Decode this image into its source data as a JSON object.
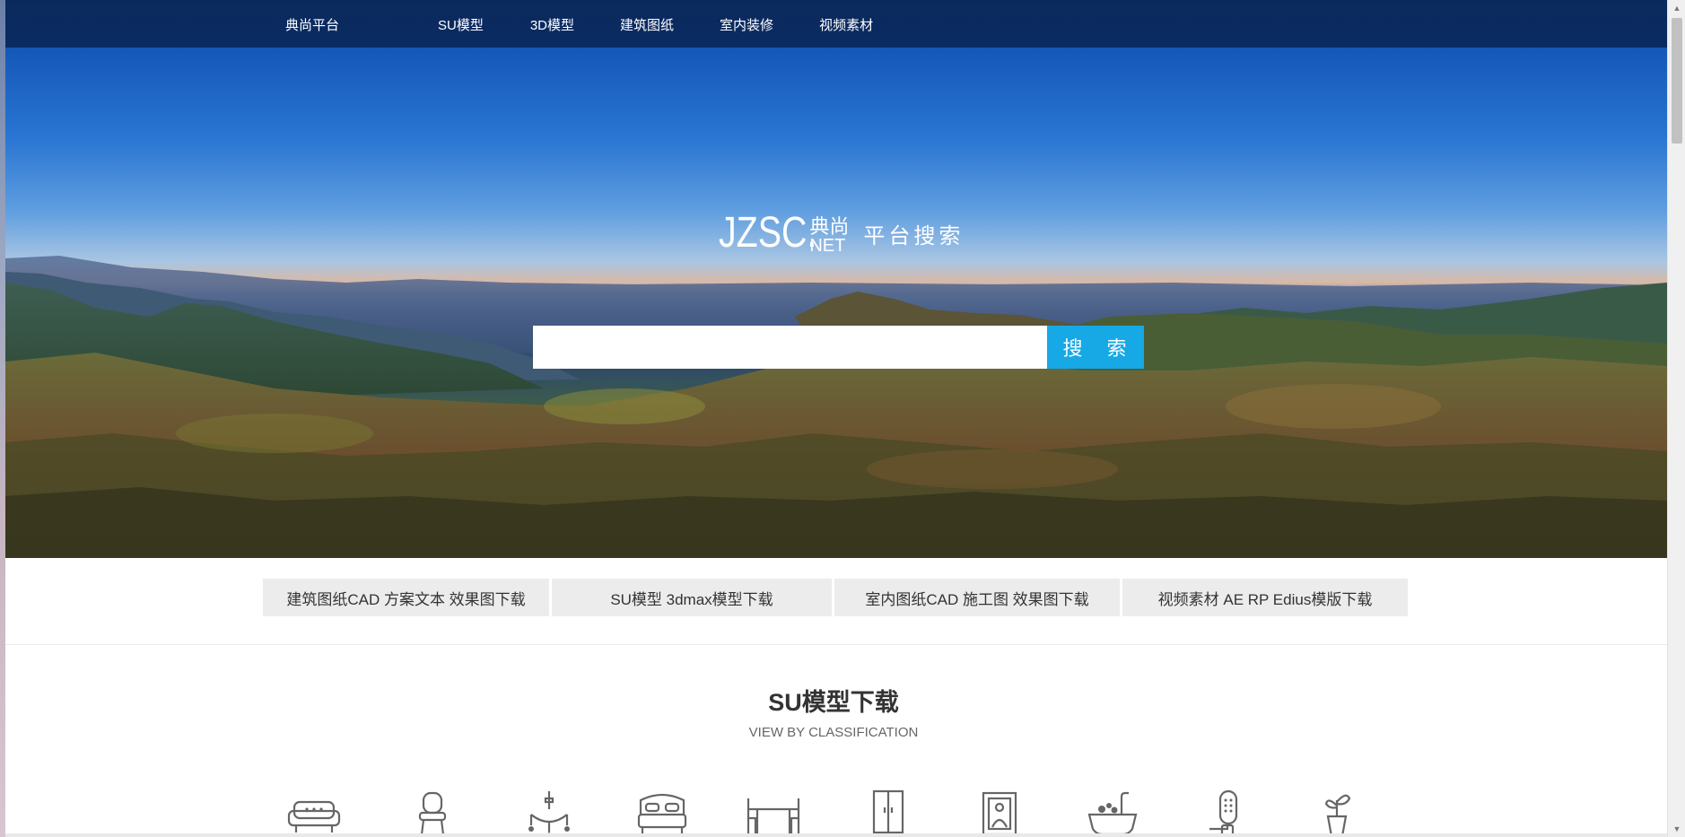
{
  "topnav": {
    "brand": "典尚平台",
    "items": [
      "SU模型",
      "3D模型",
      "建筑图纸",
      "室内装修",
      "视频素材"
    ]
  },
  "hero": {
    "logo_latin": "JZSC.",
    "logo_cn": "典尚",
    "logo_net": "NET",
    "slogan": "平台搜索",
    "search_value": "",
    "search_button": "搜 索"
  },
  "categories": [
    "建筑图纸CAD 方案文本 效果图下载",
    "SU模型 3dmax模型下载",
    "室内图纸CAD 施工图 效果图下载",
    "视频素材 AE RP Edius模版下载"
  ],
  "section": {
    "title": "SU模型下载",
    "subtitle": "VIEW BY CLASSIFICATION"
  },
  "icons": [
    "sofa-icon",
    "chair-icon",
    "chandelier-icon",
    "bed-icon",
    "dining-table-icon",
    "wardrobe-icon",
    "picture-frame-icon",
    "bathtub-icon",
    "door-lock-icon",
    "potted-plant-icon"
  ],
  "colors": {
    "nav_bg": "#0a2b63",
    "search_button": "#16a9e6",
    "category_bg": "#ececec"
  }
}
